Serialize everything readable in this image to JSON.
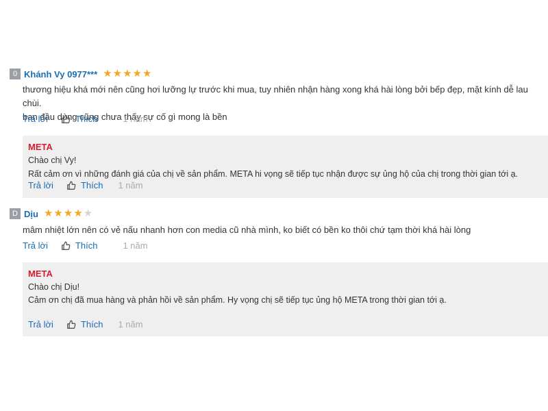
{
  "reviews": [
    {
      "avatar_letter": "0",
      "name": "Khánh Vy 0977***",
      "rating": 5,
      "max_rating": 5,
      "comment_lines": [
        "thương hiệu khá mới nên cũng hơi lưỡng lự trước khi mua, tuy nhiên nhận hàng xong khá hài lòng bởi bếp đẹp, mặt kính dễ lau chùi.",
        "ban đầu dùng cũng chưa thấy sự cố gì mong là bền"
      ],
      "reply_label": "Trả lời",
      "like_label": "Thích",
      "time": "1 năm",
      "reply": {
        "author": "META",
        "lines": [
          "Chào chị Vy!",
          "Rất cảm ơn vì những đánh giá của chị về sản phẩm. META hi vọng sẽ tiếp tục nhận được sự ủng hộ của chị trong thời gian tới ạ."
        ],
        "reply_label": "Trả lời",
        "like_label": "Thích",
        "time": "1 năm"
      }
    },
    {
      "avatar_letter": "D",
      "name": "Dịu",
      "rating": 4,
      "max_rating": 5,
      "comment_lines": [
        "mâm nhiệt lớn nên có vẻ nấu nhanh hơn con media cũ nhà mình, ko biết có bền ko thôi chứ tạm thời khá hài lòng"
      ],
      "reply_label": "Trả lời",
      "like_label": "Thích",
      "time": "1 năm",
      "reply": {
        "author": "META",
        "lines": [
          "Chào chị Dịu!",
          "Cảm ơn chị đã mua hàng và phản hồi về sản phẩm. Hy vọng chị sẽ tiếp tục ủng hộ META trong thời gian tới ạ."
        ],
        "reply_label": "Trả lời",
        "like_label": "Thích",
        "time": "1 năm"
      }
    }
  ],
  "icons": {
    "star": "star-icon",
    "like": "thumbs-up-icon"
  },
  "colors": {
    "name": "#1a6cb5",
    "star": "#f5a623",
    "reply_author": "#d21f2f",
    "reply_bg": "#efefef"
  }
}
